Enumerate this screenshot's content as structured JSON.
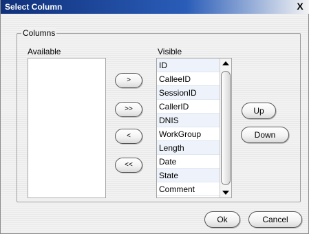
{
  "window": {
    "title": "Select Column",
    "close_glyph": "X"
  },
  "group": {
    "label": "Columns"
  },
  "available": {
    "label": "Available",
    "items": []
  },
  "visible": {
    "label": "Visible",
    "items": [
      "ID",
      "CalleeID",
      "SessionID",
      "CallerID",
      "DNIS",
      "WorkGroup",
      "Length",
      "Date",
      "State",
      "Comment"
    ]
  },
  "move_buttons": {
    "add_one": ">",
    "add_all": ">>",
    "remove_one": "<",
    "remove_all": "<<"
  },
  "order_buttons": {
    "up": "Up",
    "down": "Down"
  },
  "dialog_buttons": {
    "ok": "Ok",
    "cancel": "Cancel"
  },
  "icons": {
    "close": "close-icon",
    "scroll_up": "arrow-up-icon",
    "scroll_down": "arrow-down-icon"
  }
}
